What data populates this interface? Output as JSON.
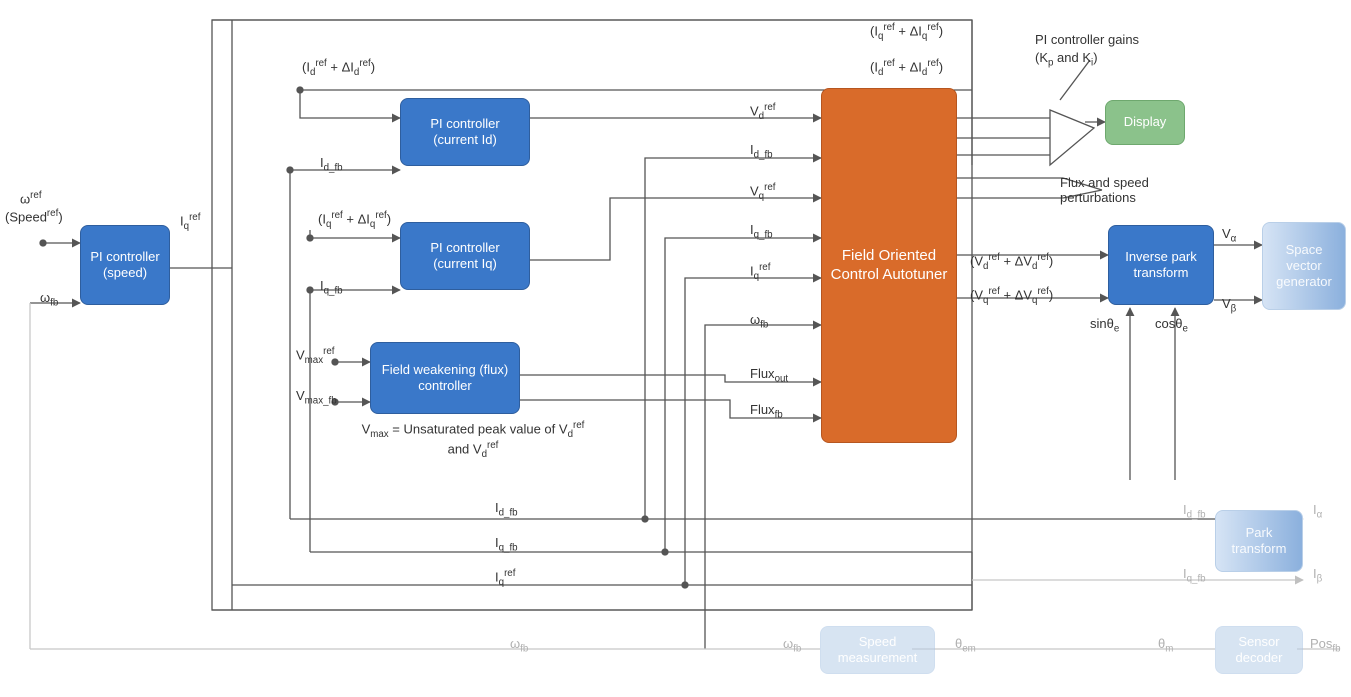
{
  "blocks": {
    "pi_speed": "PI controller (speed)",
    "pi_id": "PI controller (current Id)",
    "pi_iq": "PI controller (current Iq)",
    "field_weak": "Field weakening (flux) controller",
    "foc_autotuner": "Field Oriented Control Autotuner",
    "display": "Display",
    "inv_park": "Inverse park transform",
    "park": "Park transform",
    "svg_gen": "Space vector generator",
    "speed_meas": "Speed measurement",
    "sensor_dec": "Sensor decoder"
  },
  "labels": {
    "omega_ref": "ω<sup>ref</sup>",
    "speed_ref": "(Speed<sup>ref</sup>)",
    "omega_fb": "ω<sub>fb</sub>",
    "iq_ref": "I<sub>q</sub><sup>ref</sup>",
    "id_ref_dId": "(I<sub>d</sub><sup>ref</sup> + ΔI<sub>d</sub><sup>ref</sup>)",
    "id_fb": "I<sub>d_fb</sub>",
    "iq_ref_dIq": "(I<sub>q</sub><sup>ref</sup> + ΔI<sub>q</sub><sup>ref</sup>)",
    "iq_fb": "I<sub>q_fb</sub>",
    "vmax_ref": "V<sub>max</sub><sup>ref</sup>",
    "vmax_fb": "V<sub>max_fb</sub>",
    "vmax_note": "V<sub>max</sub> = Unsaturated peak value of V<sub>d</sub><sup>ref</sup> and V<sub>d</sub><sup>ref</sup>",
    "vd_ref": "V<sub>d</sub><sup>ref</sup>",
    "id_fb_mid": "I<sub>d_fb</sub>",
    "vq_ref": "V<sub>q</sub><sup>ref</sup>",
    "iq_fb_mid": "I<sub>q_fb</sub>",
    "iq_ref_mid": "I<sub>q</sub><sup>ref</sup>",
    "omega_fb_mid": "ω<sub>fb</sub>",
    "flux_out": "Flux<sub>out</sub>",
    "flux_fb": "Flux<sub>fb</sub>",
    "top_iq_ref_dIq": "(I<sub>q</sub><sup>ref</sup> + ΔI<sub>q</sub><sup>ref</sup>)",
    "right_id_ref_dId": "(I<sub>d</sub><sup>ref</sup> + ΔI<sub>d</sub><sup>ref</sup>)",
    "pi_gains": "PI controller gains",
    "kp_ki": "(K<sub>p</sub> and K<sub>i</sub>)",
    "flux_speed_pert": "Flux and speed perturbations",
    "vd_dvd": "(V<sub>d</sub><sup>ref</sup> + ΔV<sub>d</sub><sup>ref</sup>)",
    "vq_dvq": "(V<sub>q</sub><sup>ref</sup> + ΔV<sub>q</sub><sup>ref</sup>)",
    "sin_theta": "sinθ<sub>e</sub>",
    "cos_theta": "cosθ<sub>e</sub>",
    "v_alpha": "V<sub>α</sub>",
    "v_beta": "V<sub>β</sub>",
    "id_fb_bot": "I<sub>d_fb</sub>",
    "iq_fb_bot": "I<sub>q_fb</sub>",
    "iq_ref_bot": "I<sub>q</sub><sup>ref</sup>",
    "omega_fb_bot": "ω<sub>fb</sub>",
    "omega_fb_bot2": "ω<sub>fb</sub>",
    "theta_em": "θ<sub>em</sub>",
    "theta_m": "θ<sub>m</sub>",
    "i_alpha": "I<sub>α</sub>",
    "i_beta": "I<sub>β</sub>",
    "pos_fb": "Pos<sub>fb</sub>"
  }
}
